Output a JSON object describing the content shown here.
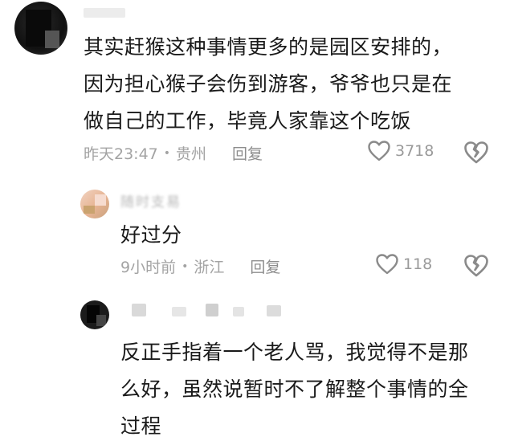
{
  "comments": [
    {
      "text_lines": [
        "其实赶猴这种事情更多的是园区安排的，",
        "因为担心猴子会伤到游客，爷爷也只是在",
        "做自己的工作，毕竟人家靠这个吃饭"
      ],
      "time": "昨天23:47",
      "location": "贵州",
      "reply_label": "回复",
      "likes": "3718"
    },
    {
      "nickname": "随时支易",
      "text_lines": [
        "好过分"
      ],
      "time": "9小时前",
      "location": "浙江",
      "reply_label": "回复",
      "likes": "118"
    },
    {
      "text_lines": [
        "反正手指着一个老人骂，我觉得不是那",
        "么好，虽然说暂时不了解整个事情的全",
        "过程"
      ]
    }
  ],
  "icons": {
    "like": "heart-outline-icon",
    "dislike": "broken-heart-icon"
  },
  "colors": {
    "text": "#1a1a1a",
    "meta": "#a3a3a3",
    "icon": "#8a8a8a"
  }
}
